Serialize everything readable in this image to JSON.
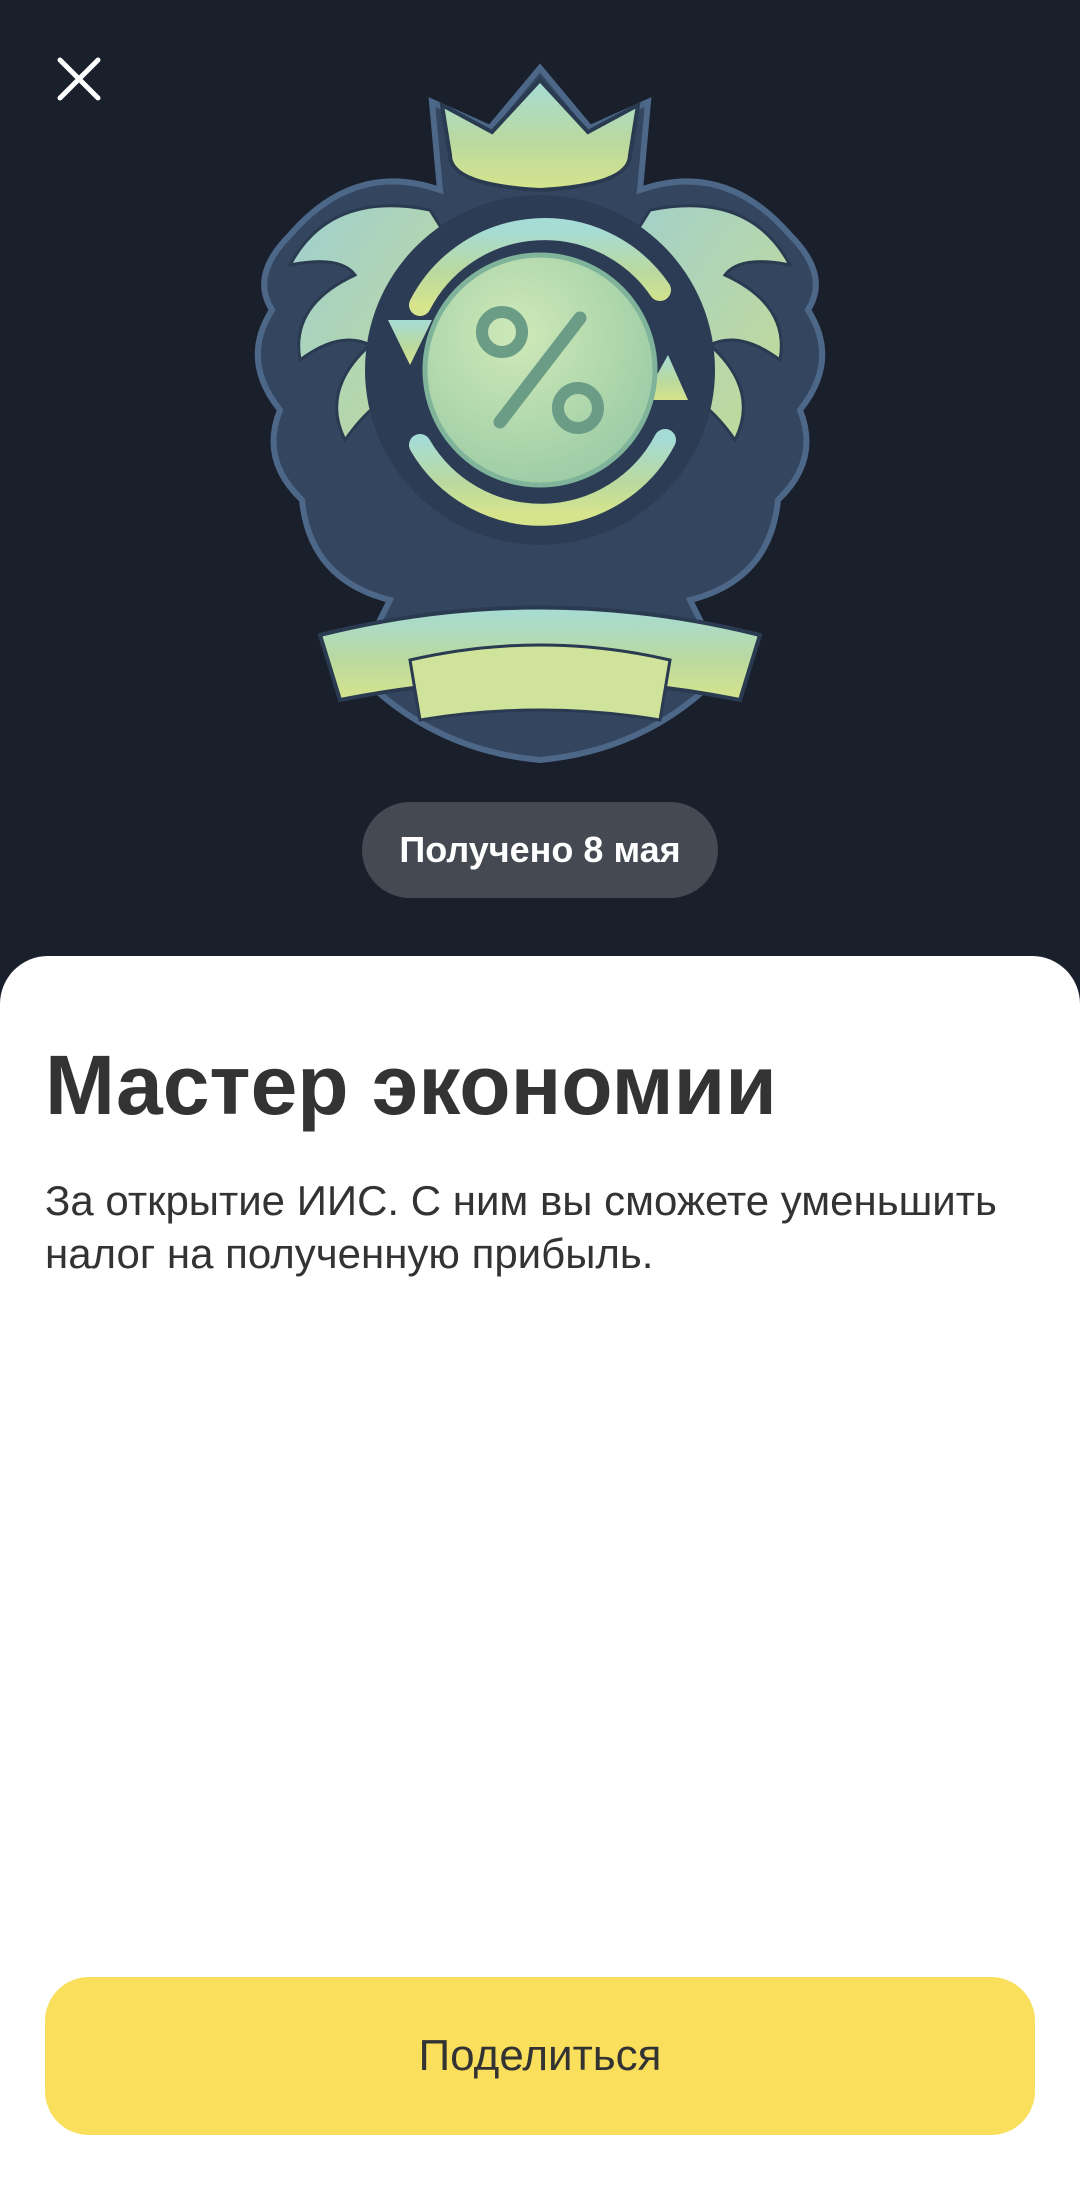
{
  "header": {
    "close_icon": "close-icon",
    "badge_icon": "percent-crest-icon",
    "received_label": "Получено 8 мая"
  },
  "achievement": {
    "title": "Мастер экономии",
    "description": "За открытие ИИС. С ним вы сможете уменьшить налог на полученную прибыль."
  },
  "actions": {
    "share_label": "Поделиться"
  },
  "colors": {
    "background": "#1a1f2c",
    "pill": "#454952",
    "sheet": "#ffffff",
    "text": "#333333",
    "accent": "#fadf5c"
  }
}
